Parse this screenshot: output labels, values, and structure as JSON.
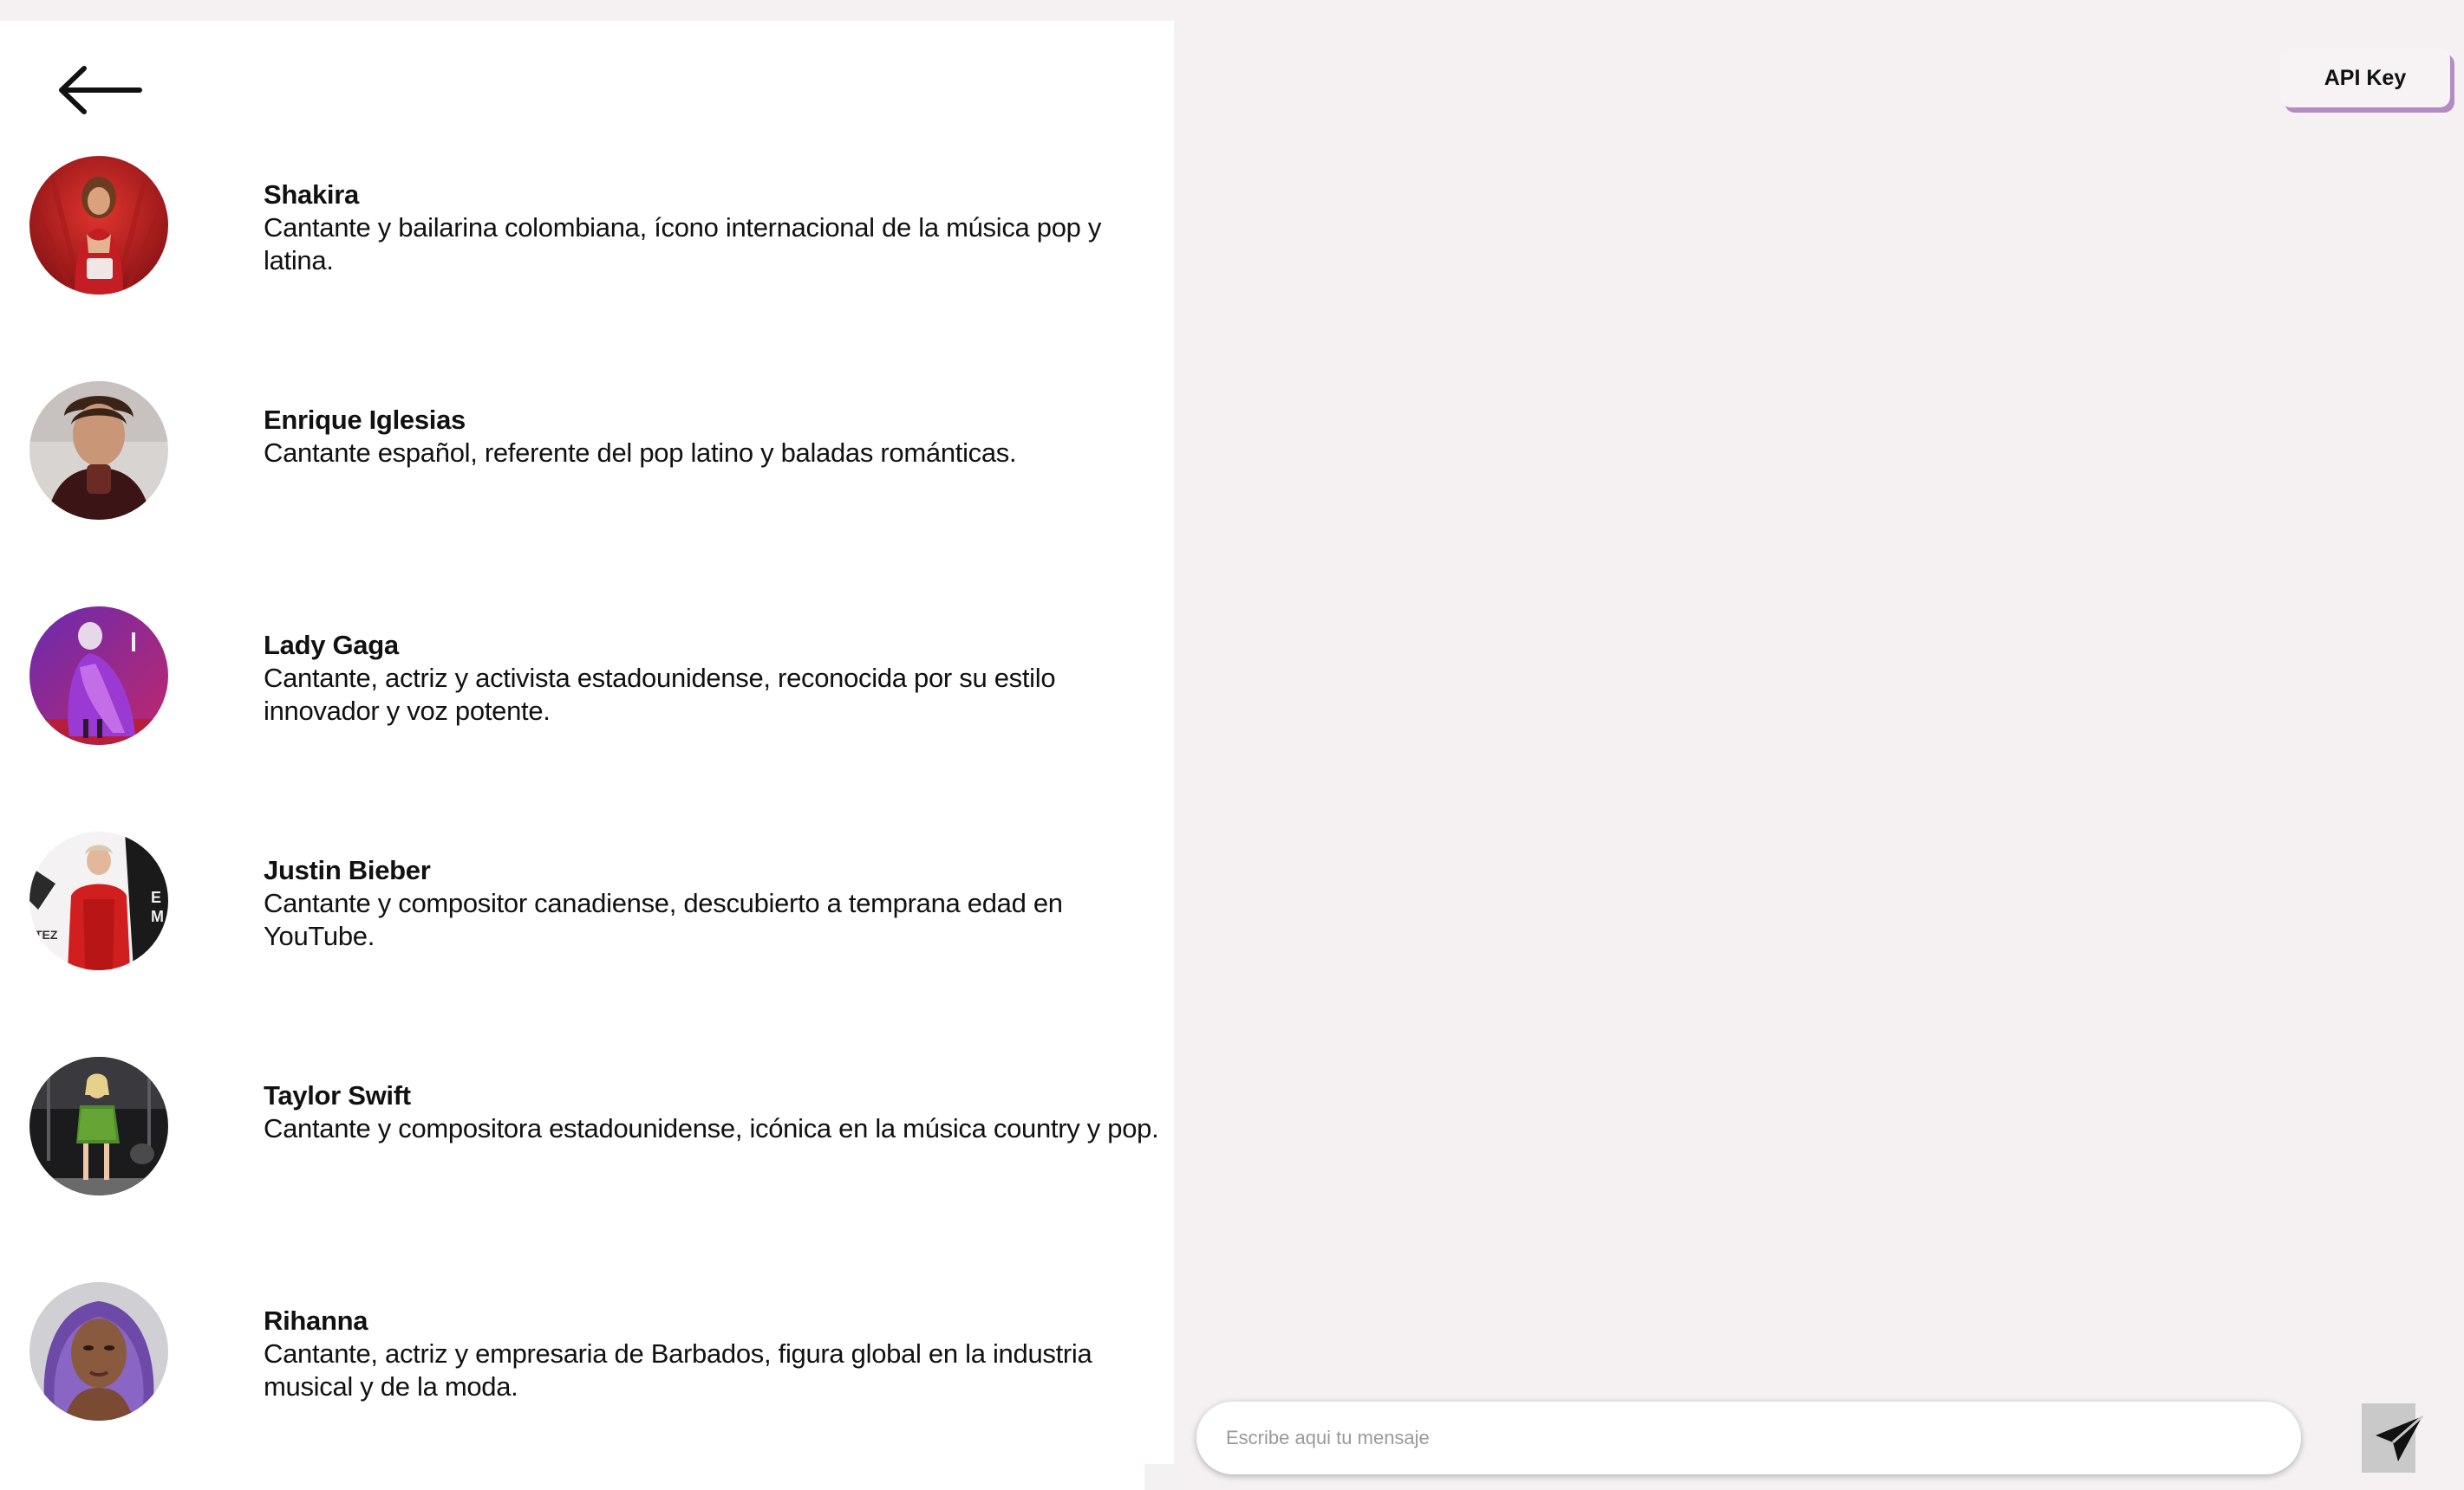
{
  "navigation": {
    "back_icon": "arrow-left-icon"
  },
  "header": {
    "api_key_label": "API Key"
  },
  "contacts": [
    {
      "name": "Shakira",
      "description": "Cantante y bailarina colombiana, ícono internacional de la música pop y latina."
    },
    {
      "name": "Enrique Iglesias",
      "description": "Cantante español, referente del pop latino y baladas románticas."
    },
    {
      "name": "Lady Gaga",
      "description": "Cantante, actriz y activista estadounidense, reconocida por su estilo innovador y voz potente."
    },
    {
      "name": "Justin Bieber",
      "description": "Cantante y compositor canadiense, descubierto a temprana edad en YouTube."
    },
    {
      "name": "Taylor Swift",
      "description": "Cantante y compositora estadounidense, icónica en la música country y pop."
    },
    {
      "name": "Rihanna",
      "description": "Cantante, actriz y empresaria de Barbados, figura global en la industria musical y de la moda."
    }
  ],
  "composer": {
    "placeholder": "Escribe aqui tu mensaje",
    "value": "",
    "send_icon": "paper-plane-icon"
  },
  "colors": {
    "page_background": "#f5f1f3",
    "panel_background": "#ffffff",
    "api_key_accent": "#b48bc2",
    "send_button_background": "#c9c9c9"
  }
}
